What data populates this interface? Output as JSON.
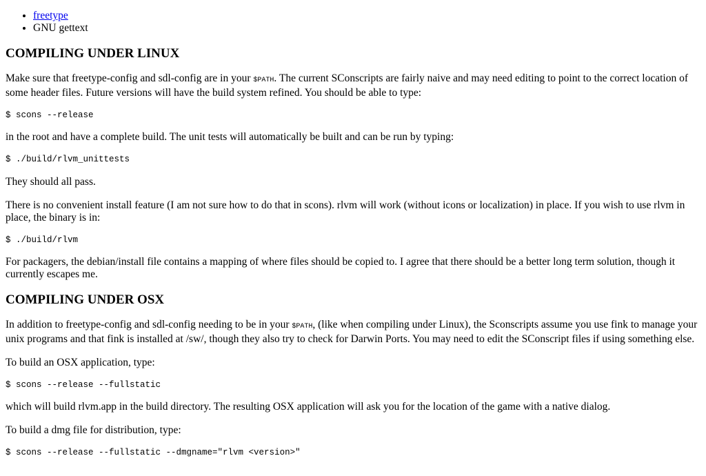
{
  "dependencies": {
    "items": [
      {
        "label": "freetype",
        "is_link": true
      },
      {
        "label": "GNU gettext",
        "is_link": false
      }
    ]
  },
  "linux": {
    "heading": "COMPILING UNDER LINUX",
    "p1_before": "Make sure that freetype-config and sdl-config are in your ",
    "p1_code": "$PATH",
    "p1_after": ". The current SConscripts are fairly naive and may need editing to point to the correct location of some header files. Future versions will have the build system refined. You should be able to type:",
    "cmd1": "$ scons --release",
    "p2": "in the root and have a complete build. The unit tests will automatically be built and can be run by typing:",
    "cmd2": "$ ./build/rlvm_unittests",
    "p3": "They should all pass.",
    "p4": "There is no convenient install feature (I am not sure how to do that in scons). rlvm will work (without icons or localization) in place. If you wish to use rlvm in place, the binary is in:",
    "cmd3": "$ ./build/rlvm",
    "p5": "For packagers, the debian/install file contains a mapping of where files should be copied to. I agree that there should be a better long term solution, though it currently escapes me."
  },
  "osx": {
    "heading": "COMPILING UNDER OSX",
    "p1_before": "In addition to freetype-config and sdl-config needing to be in your ",
    "p1_code": "$PATH",
    "p1_after": ", (like when compiling under Linux), the Sconscripts assume you use fink to manage your unix programs and that fink is installed at /sw/, though they also try to check for Darwin Ports. You may need to edit the SConscript files if using something else.",
    "p2": "To build an OSX application, type:",
    "cmd1": "$ scons --release --fullstatic",
    "p3": "which will build rlvm.app in the build directory. The resulting OSX application will ask you for the location of the game with a native dialog.",
    "p4": "To build a dmg file for distribution, type:",
    "cmd2": "$ scons --release --fullstatic --dmgname=\"rlvm <version>\""
  }
}
